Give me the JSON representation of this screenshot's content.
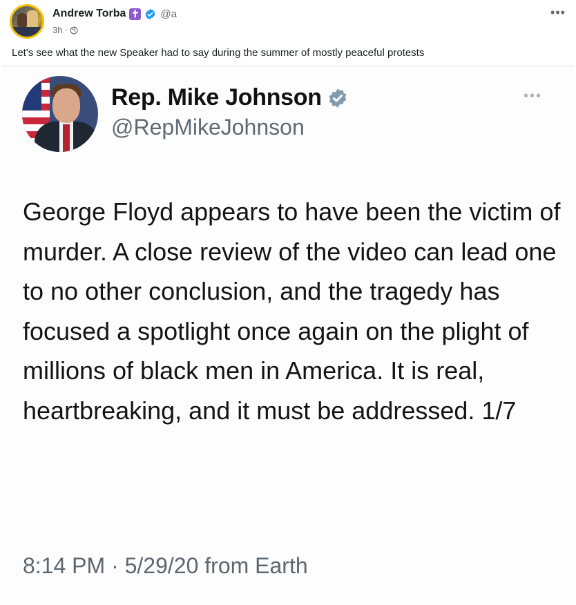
{
  "post": {
    "author_name": "Andrew Torba",
    "author_badge_glyph": "✝",
    "author_handle": "@a",
    "time": "3h",
    "meta_separator": "·",
    "more_glyph": "•••",
    "text": "Let's see what the new Speaker had to say during the summer of mostly peaceful protests"
  },
  "embedded_tweet": {
    "name": "Rep. Mike Johnson",
    "handle": "@RepMikeJohnson",
    "more_glyph": "•••",
    "body": "George Floyd appears to have been the victim of murder. A close review of the video can lead one to no other conclusion, and the tragedy has focused a spotlight once again on the plight of millions of black men in America. It is real, heartbreaking, and it must be addressed. 1/7",
    "footer": "8:14 PM · 5/29/20 from Earth"
  },
  "icons": {
    "author_badge": "cross-badge-icon",
    "verified": "verified-check-icon",
    "audience": "globe-icon",
    "more": "more-options-icon"
  },
  "colors": {
    "verified_blue": "#1d9bf0",
    "cross_badge_purple": "#8e5cc9",
    "avatar_ring": "#f2c200",
    "tweet_verified_gray": "#829aab"
  }
}
